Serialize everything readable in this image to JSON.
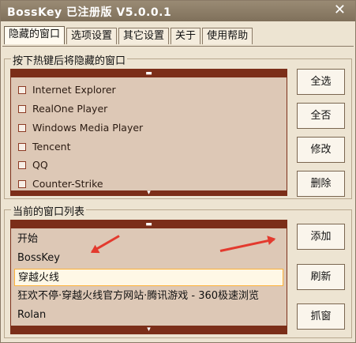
{
  "window": {
    "title": "BossKey 已注册版 V5.0.0.1",
    "close_symbol": "✕"
  },
  "tabs": [
    {
      "label": "隐藏的窗口"
    },
    {
      "label": "选项设置"
    },
    {
      "label": "其它设置"
    },
    {
      "label": "关于"
    },
    {
      "label": "使用帮助"
    }
  ],
  "hotkey_group": {
    "title": "按下热键后将隐藏的窗口",
    "scroll_up": "▬",
    "scroll_down": "▾",
    "items": [
      {
        "label": "Internet Explorer",
        "checked": false
      },
      {
        "label": "RealOne Player",
        "checked": false
      },
      {
        "label": "Windows Media Player",
        "checked": false
      },
      {
        "label": "Tencent",
        "checked": false
      },
      {
        "label": "QQ",
        "checked": false
      },
      {
        "label": "Counter-Strike",
        "checked": false
      }
    ],
    "buttons": {
      "select_all": "全选",
      "select_none": "全否",
      "modify": "修改",
      "delete": "删除"
    }
  },
  "window_list_group": {
    "title": "当前的窗口列表",
    "scroll_up": "▬",
    "scroll_down": "▾",
    "items": [
      {
        "label": "开始",
        "selected": false
      },
      {
        "label": "BossKey",
        "selected": false
      },
      {
        "label": "穿越火线",
        "selected": true
      },
      {
        "label": "狂欢不停·穿越火线官方网站·腾讯游戏 - 360极速浏览",
        "selected": false
      },
      {
        "label": "Rolan",
        "selected": false
      }
    ],
    "buttons": {
      "add": "添加",
      "refresh": "刷新",
      "grab": "抓窗"
    }
  },
  "colors": {
    "list_background": "#ddc8b6",
    "list_border": "#7b2e19",
    "selection_border": "#ffb33a",
    "arrow": "#e33a2e"
  }
}
